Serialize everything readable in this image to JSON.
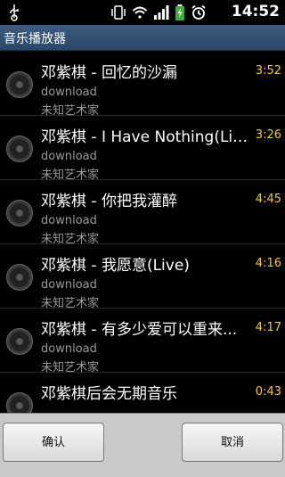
{
  "status_bar": {
    "time": "14:52",
    "icons": [
      "usb-icon",
      "vibrate-icon",
      "wifi-icon",
      "signal-icon",
      "battery-icon",
      "alarm-icon"
    ]
  },
  "app": {
    "title": "音乐播放器"
  },
  "songs": [
    {
      "title": "邓紫棋 - 回忆的沙漏",
      "duration": "3:52",
      "album": "download",
      "artist": "未知艺术家"
    },
    {
      "title": "邓紫棋 - I Have Nothing(Live)",
      "duration": "3:26",
      "album": "download",
      "artist": "未知艺术家"
    },
    {
      "title": "邓紫棋 - 你把我灌醉",
      "duration": "4:45",
      "album": "download",
      "artist": "未知艺术家"
    },
    {
      "title": "邓紫棋 - 我愿意(Live)",
      "duration": "4:16",
      "album": "download",
      "artist": "未知艺术家"
    },
    {
      "title": "邓紫棋 - 有多少爱可以重来...",
      "duration": "4:17",
      "album": "download",
      "artist": "未知艺术家"
    },
    {
      "title": "邓紫棋后会无期音乐",
      "duration": "0:43",
      "album": "",
      "artist": ""
    }
  ],
  "buttons": {
    "confirm": "确认",
    "cancel": "取消"
  },
  "colors": {
    "titlebar": "#2f4d72",
    "duration": "#f5c542",
    "secondary_text": "#9a9a9a"
  }
}
